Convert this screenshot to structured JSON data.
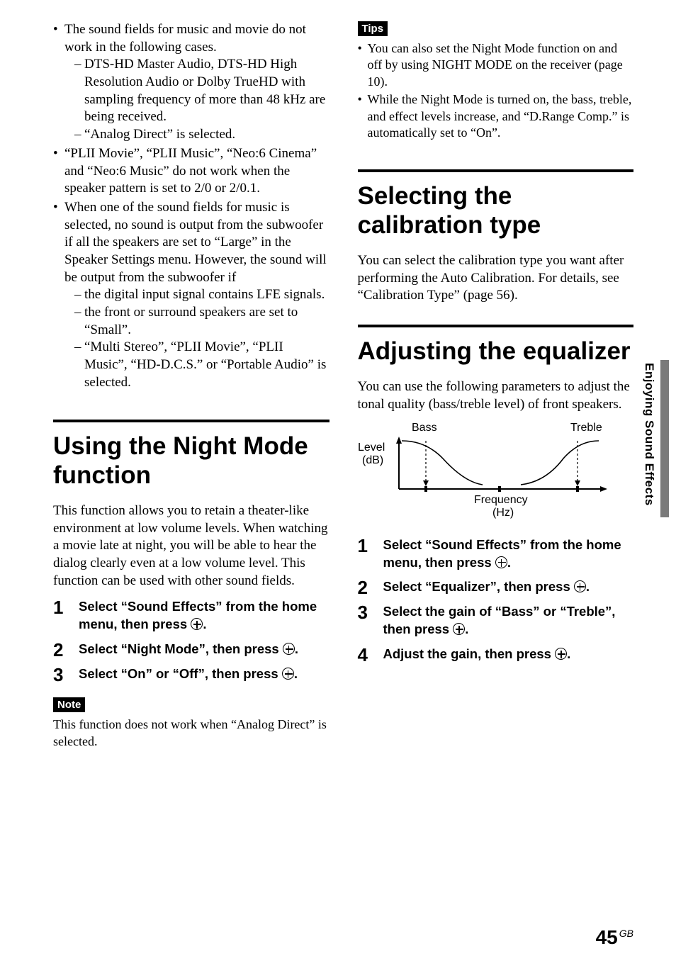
{
  "left": {
    "bullets": [
      {
        "text": "The sound fields for music and movie do not work in the following cases.",
        "sub": [
          "DTS-HD Master Audio, DTS-HD High Resolution Audio or Dolby TrueHD with sampling frequency of more than 48 kHz are being received.",
          "“Analog Direct” is selected."
        ]
      },
      {
        "text": "“PLII Movie”, “PLII Music”, “Neo:6 Cinema” and “Neo:6 Music” do not work when the speaker pattern is set to 2/0 or 2/0.1."
      },
      {
        "text": "When one of the sound fields for music is selected, no sound is output from the subwoofer if all the speakers are set to “Large” in the Speaker Settings menu. However, the sound will be output from the subwoofer if",
        "sub": [
          "the digital input signal contains LFE signals.",
          "the front or surround speakers are set to “Small”.",
          "“Multi Stereo”, “PLII Movie”, “PLII Music”, “HD-D.C.S.” or “Portable Audio” is selected."
        ]
      }
    ],
    "night_mode": {
      "title": "Using the Night Mode function",
      "intro": "This function allows you to retain a theater-like environment at low volume levels. When watching a movie late at night, you will be able to hear the dialog clearly even at a low volume level. This function can be used with other sound fields.",
      "steps": [
        {
          "pre": "Select “Sound Effects” from the home menu, then press ",
          "post": "."
        },
        {
          "pre": "Select “Night Mode”, then press ",
          "post": "."
        },
        {
          "pre": "Select “On” or “Off”,  then press ",
          "post": "."
        }
      ],
      "note_label": "Note",
      "note_text": "This function does not work when “Analog Direct” is selected."
    }
  },
  "right": {
    "tips_label": "Tips",
    "tips": [
      "You can also set the Night Mode function on and off by using NIGHT MODE on the receiver (page 10).",
      "While the Night Mode is turned on, the bass, treble, and effect levels increase, and “D.Range Comp.” is automatically set to “On”."
    ],
    "calibration": {
      "title": "Selecting the calibration type",
      "text": "You can select the calibration type you want after performing the Auto Calibration. For details, see “Calibration Type” (page 56)."
    },
    "equalizer": {
      "title": "Adjusting the equalizer",
      "intro": "You can use the following parameters to adjust the tonal quality (bass/treble level) of front speakers.",
      "diagram": {
        "bass": "Bass",
        "treble": "Treble",
        "level": "Level\n(dB)",
        "freq": "Frequency\n(Hz)"
      },
      "steps": [
        {
          "pre": "Select “Sound Effects” from the home menu, then press ",
          "post": "."
        },
        {
          "pre": "Select “Equalizer”, then press ",
          "post": "."
        },
        {
          "pre": "Select the gain of “Bass” or “Treble”, then press ",
          "post": "."
        },
        {
          "pre": "Adjust the gain, then press ",
          "post": "."
        }
      ]
    }
  },
  "side_tab": "Enjoying Sound Effects",
  "page": {
    "num": "45",
    "lang": "GB"
  }
}
